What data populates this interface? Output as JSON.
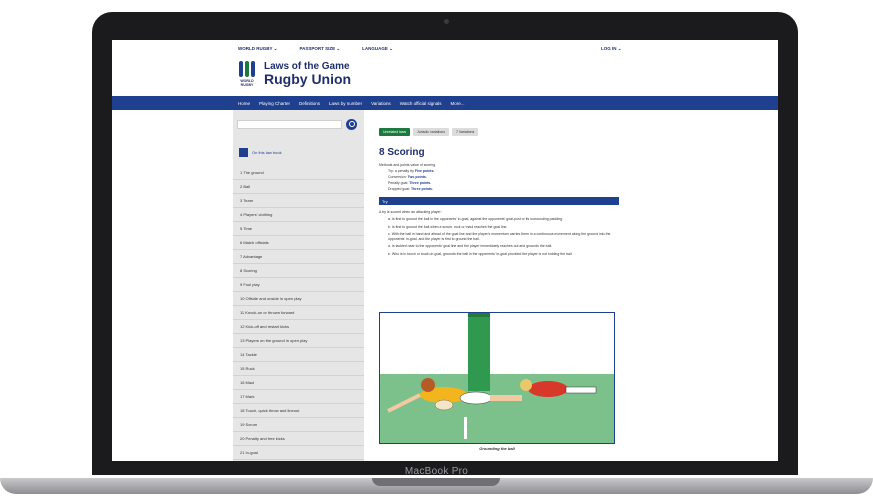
{
  "device": {
    "label": "MacBook Pro"
  },
  "topbar": {
    "items": [
      "WORLD RUGBY ⌄",
      "PASSPORT SIZE ⌄",
      "LANGUAGE ⌄"
    ],
    "login": "LOG IN ⌄"
  },
  "brand": {
    "logo_text": "WORLD RUGBY",
    "title_line1": "Laws of the Game",
    "title_line2": "Rugby Union",
    "colors": {
      "navy": "#1f2f6b",
      "blue": "#1f3f8f",
      "green": "#1b7a3e"
    }
  },
  "nav": {
    "items": [
      "Home",
      "Playing Charter",
      "Definitions",
      "Laws by number",
      "Variations",
      "Watch official signals",
      "More..."
    ]
  },
  "sidebar": {
    "search_placeholder": "",
    "edit_label": "On this law book",
    "laws": [
      "1 The ground",
      "2 Ball",
      "3 Team",
      "4 Players' clothing",
      "5 Time",
      "6 Match officials",
      "7 Advantage",
      "8 Scoring",
      "9 Foul play",
      "10 Offside and onside in open play",
      "11 Knock-on or thrown forward",
      "12 Kick-off and restart kicks",
      "13 Players on the ground in open play",
      "14 Tackle",
      "15 Ruck",
      "16 Maul",
      "17 Mark",
      "18 Touch, quick throw and lineout",
      "19 Scrum",
      "20 Penalty and free kicks",
      "21 In-goal"
    ]
  },
  "content": {
    "tabs": [
      "Unrelated laws",
      "Jurisdic variations",
      "7 Variations"
    ],
    "title": "8 Scoring",
    "intro": "Methods and points value of scoring.",
    "points": [
      {
        "label": "Try: a penalty try",
        "value": "Five points."
      },
      {
        "label": "Conversion:",
        "value": "Two points."
      },
      {
        "label": "Penalty goal:",
        "value": "Three points."
      },
      {
        "label": "Dropped goal:",
        "value": "Three points."
      }
    ],
    "section_label": "Try",
    "section_intro": "A try is scored when an attacking player:",
    "try_items": [
      "a. Is first to ground the ball in the opponents' in-goal, against the opponents' goal-post or its surrounding padding.",
      "b. Is first to ground the ball when a scrum, ruck or maul reaches the goal line.",
      "c. With the ball in hand and ahead of the goal line and the player's momentum carries them in a continuous movement along the ground into the opponents' in-goal, and the player is first to ground the ball.",
      "d. Is tackled near to the opponents' goal line and the player immediately reaches out and grounds the ball.",
      "e. Who is in touch or touch-in-goal, grounds the ball in the opponents' in-goal provided the player is not holding the ball."
    ],
    "caption": "Grounding the ball"
  }
}
